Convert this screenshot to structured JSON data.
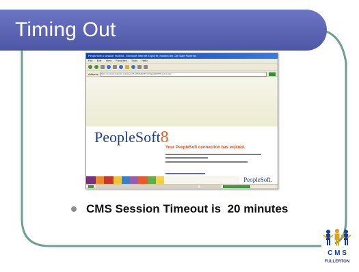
{
  "slide": {
    "title": "Timing Out",
    "bullet": "CMS Session Timeout is  20 minutes"
  },
  "browser": {
    "title_bar_text": "PeopleSoft 8 session expired - Microsoft Internet Explorer provided by Cal State Fullerton",
    "menu_items": [
      "File",
      "Edit",
      "View",
      "Favorites",
      "Tools",
      "Help"
    ],
    "address_label": "Address",
    "address_url": "https://cmsweb.fullerton.edu/psp/HFULPRD/EMPLOYEE/HRMS/?cmd=expire",
    "go_label": "Go",
    "page": {
      "logo_text": "PeopleSoft",
      "logo_version": "8",
      "expired_message": "Your PeopleSoft connection has expired.",
      "info_line_1": "For your security, this site expires connections after a delay of 20 minutes.",
      "info_line_2": "If you would like to perform further transactions please:",
      "signin_link": "Return to PeopleSoft Sign-in",
      "footer_logo": "PeopleSoft."
    }
  },
  "logo": {
    "line1": "C M S",
    "line2": "FULLERTON"
  },
  "colors": {
    "title_bar": "#5a62b0",
    "frame_line": "#6f9e92",
    "title_text": "#ffffff",
    "peoplesoft_blue": "#1f3f86",
    "peoplesoft_orange": "#e4602a",
    "logo_gold": "#d7a521",
    "logo_blue": "#1c3f8f"
  }
}
